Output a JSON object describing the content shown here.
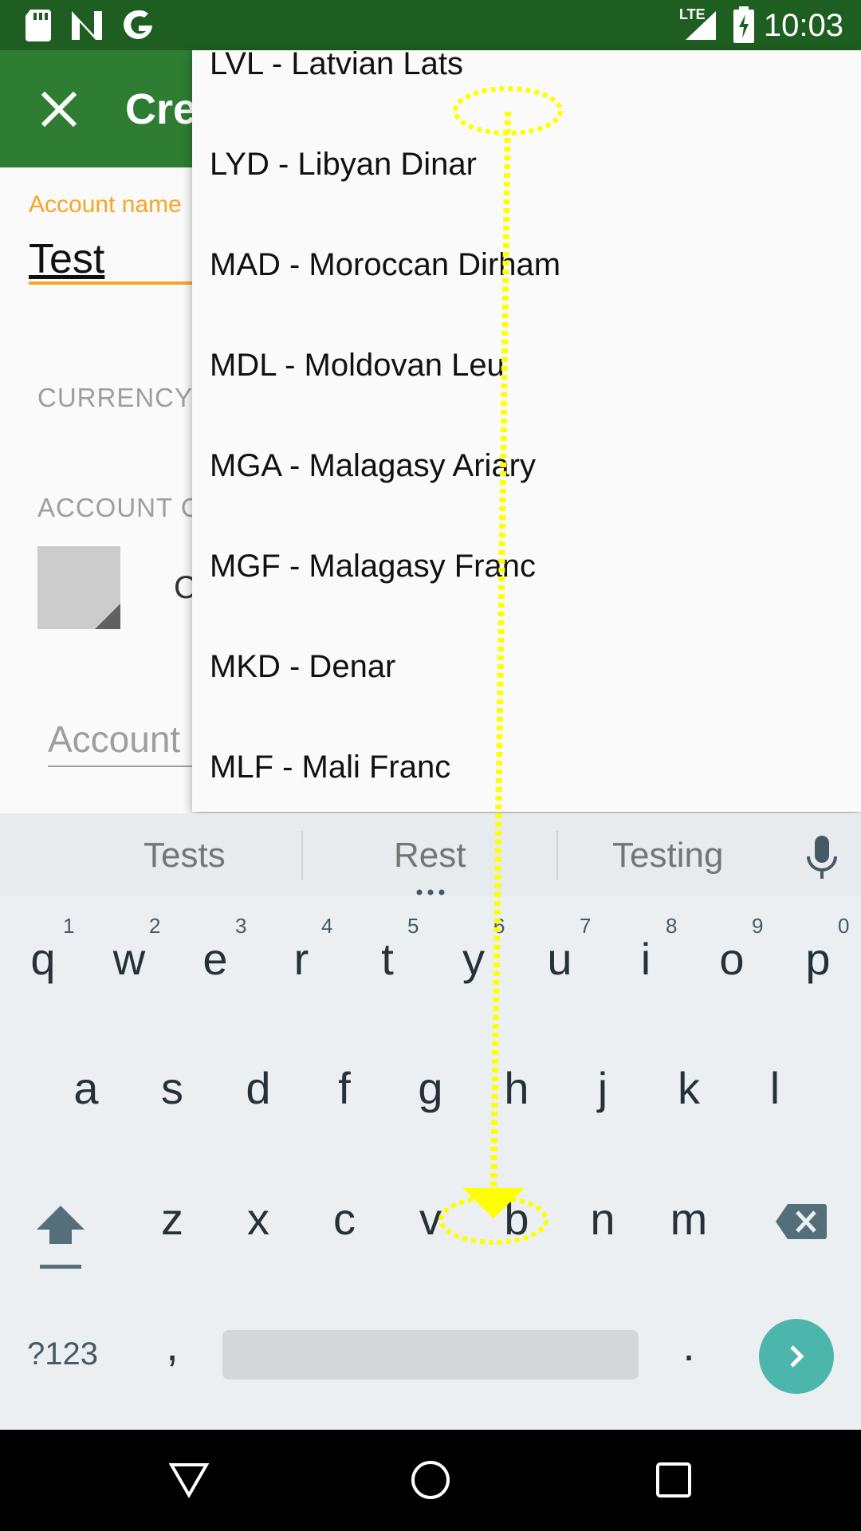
{
  "status_bar": {
    "time": "10:03",
    "network": "LTE",
    "icons": [
      "sd-card-icon",
      "n-icon",
      "google-icon",
      "lte-signal-icon",
      "battery-charging-icon"
    ]
  },
  "toolbar": {
    "title": "Cre",
    "close_icon": "close-icon"
  },
  "form": {
    "account_name_label": "Account name",
    "account_name_value": "Test",
    "currency_label": "CURRENCY",
    "account_color_label": "ACCOUNT C",
    "color_text": "C",
    "description_placeholder": "Account"
  },
  "currency_dropdown": {
    "options": [
      "LVL - Latvian Lats",
      "LYD - Libyan Dinar",
      "MAD - Moroccan Dirham",
      "MDL - Moldovan Leu",
      "MGA - Malagasy Ariary",
      "MGF - Malagasy Franc",
      "MKD - Denar",
      "MLF - Mali Franc"
    ]
  },
  "keyboard": {
    "suggestions": [
      "Tests",
      "Rest",
      "Testing"
    ],
    "row1": [
      "q",
      "w",
      "e",
      "r",
      "t",
      "y",
      "u",
      "i",
      "o",
      "p"
    ],
    "row1_hints": [
      "1",
      "2",
      "3",
      "4",
      "5",
      "6",
      "7",
      "8",
      "9",
      "0"
    ],
    "row2": [
      "a",
      "s",
      "d",
      "f",
      "g",
      "h",
      "j",
      "k",
      "l"
    ],
    "row3": [
      "z",
      "x",
      "c",
      "v",
      "b",
      "n",
      "m"
    ],
    "symbols_key": "?123",
    "comma_key": ",",
    "period_key": "."
  },
  "gesture": {
    "type": "swipe-down",
    "color": "#ffff00"
  }
}
